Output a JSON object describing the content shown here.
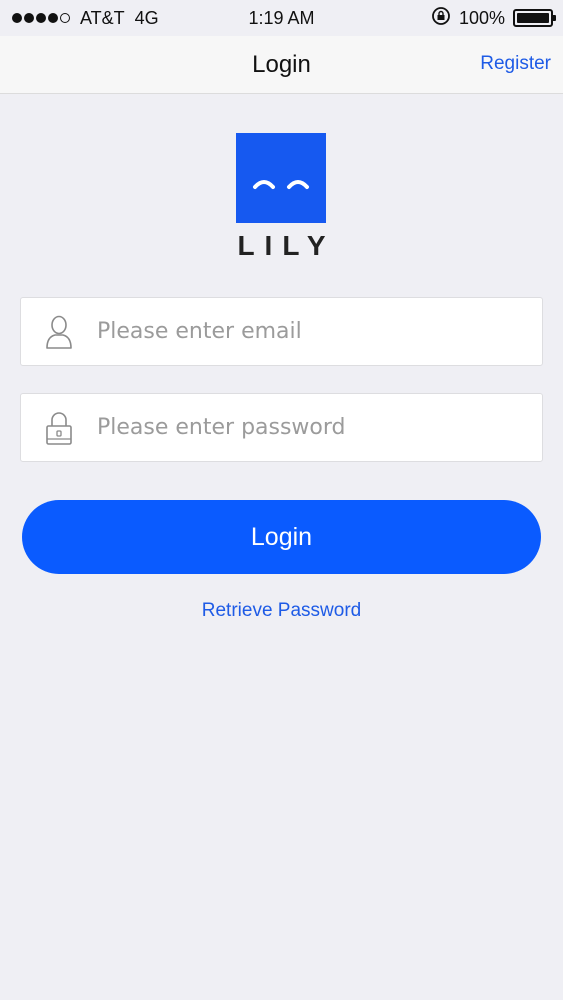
{
  "status_bar": {
    "carrier": "AT&T",
    "network": "4G",
    "time": "1:19 AM",
    "battery": "100%",
    "signal_bars_filled": 4,
    "signal_bars_total": 5,
    "battery_level": 1.0
  },
  "nav": {
    "title": "Login",
    "register_label": "Register"
  },
  "logo": {
    "text": "LILY",
    "color": "#1659f0"
  },
  "form": {
    "email_placeholder": "Please enter email",
    "email_value": "",
    "password_placeholder": "Please enter password",
    "password_value": "",
    "login_label": "Login",
    "retrieve_label": "Retrieve Password"
  },
  "colors": {
    "accent": "#0a5bff",
    "link": "#1e5be6",
    "background": "#efeff4"
  },
  "icons": {
    "email": "user-icon",
    "password": "lock-icon"
  }
}
